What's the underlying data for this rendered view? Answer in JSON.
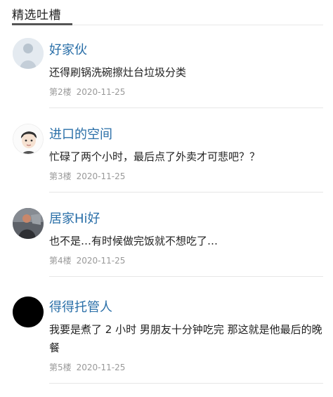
{
  "section": {
    "title": "精选吐槽"
  },
  "comments": [
    {
      "username": "好家伙",
      "content": "还得刷锅洗碗擦灶台垃圾分类",
      "floor": "第2楼",
      "date": "2020-11-25",
      "avatar": "avatar-1"
    },
    {
      "username": "进口的空间",
      "content": "忙碌了两个小时，最后点了外卖才可悲吧？？",
      "floor": "第3楼",
      "date": "2020-11-25",
      "avatar": "avatar-2"
    },
    {
      "username": "居家Hi好",
      "content": "也不是…有时候做完饭就不想吃了…",
      "floor": "第4楼",
      "date": "2020-11-25",
      "avatar": "avatar-3"
    },
    {
      "username": "得得托管人",
      "content": "我要是煮了 2 小时 男朋友十分钟吃完 那这就是他最后的晚餐",
      "floor": "第5楼",
      "date": "2020-11-25",
      "avatar": "avatar-4"
    }
  ]
}
